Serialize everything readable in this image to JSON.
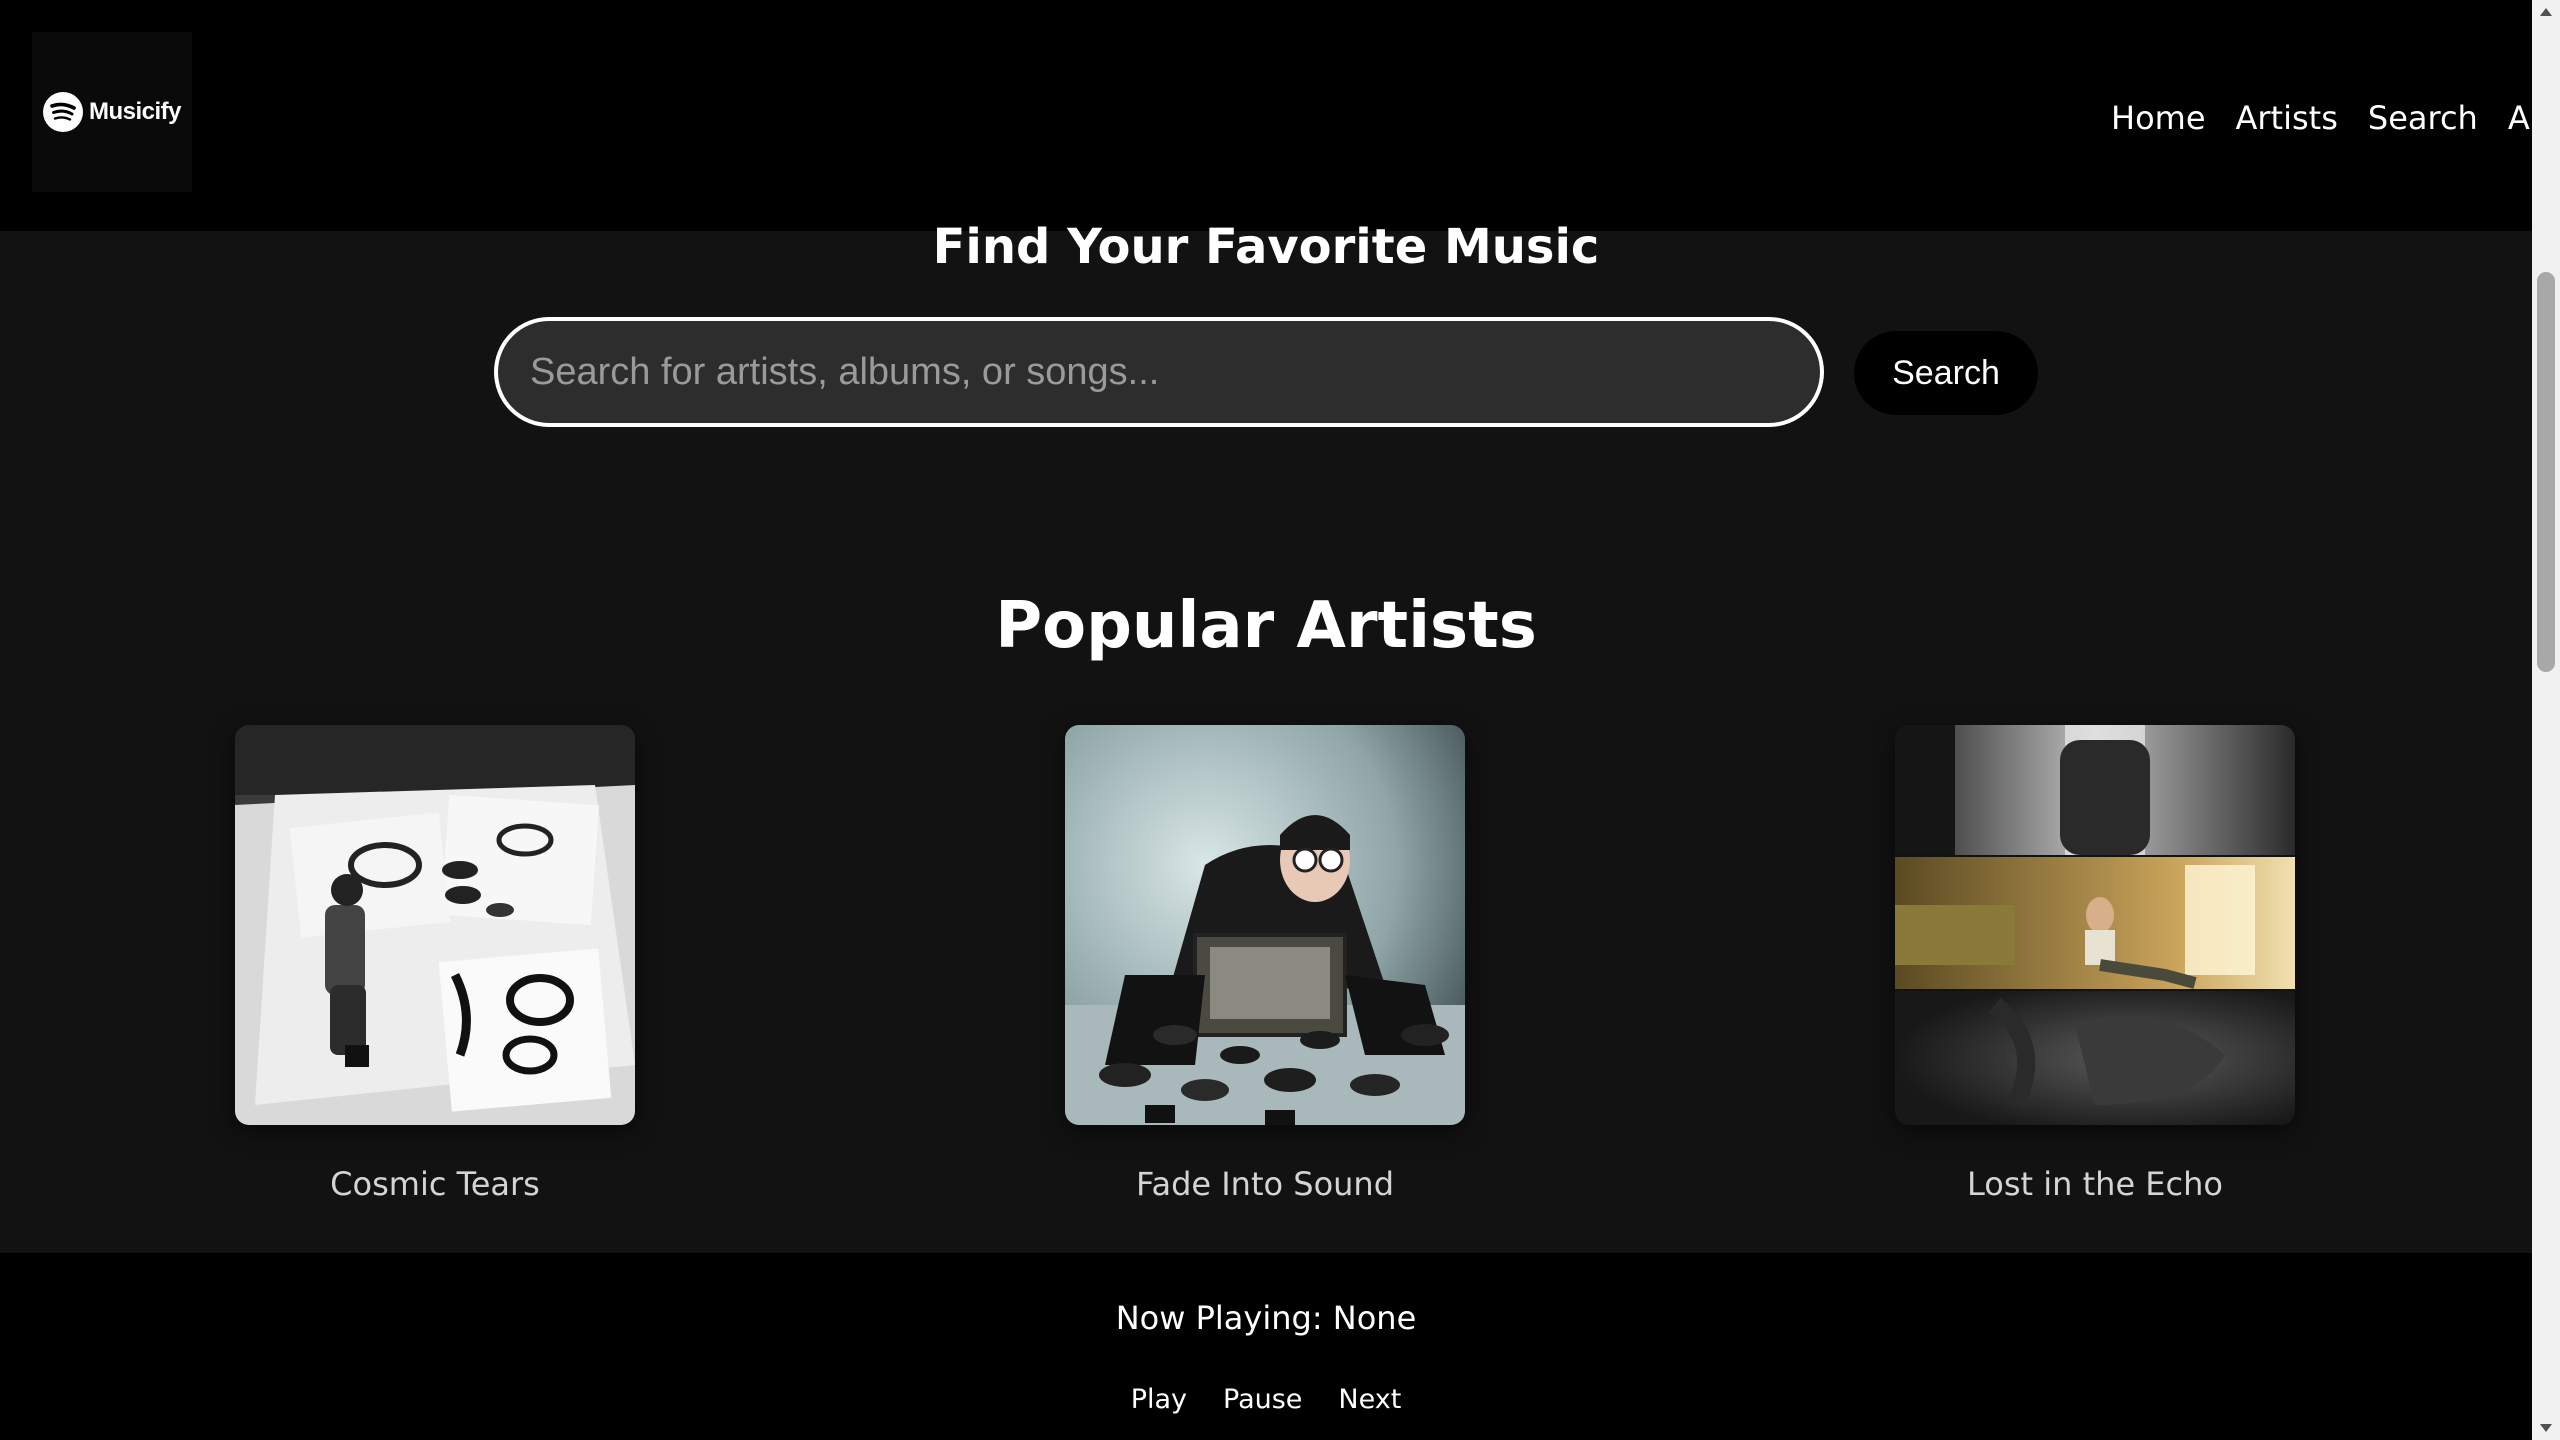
{
  "header": {
    "logo_text": "Musicify",
    "nav": [
      "Home",
      "Artists",
      "Search",
      "Albu"
    ]
  },
  "hero": {
    "title": "Find Your Favorite Music",
    "search_placeholder": "Search for artists, albums, or songs...",
    "search_button": "Search"
  },
  "popular": {
    "title": "Popular Artists",
    "artists": [
      {
        "name": "Cosmic Tears"
      },
      {
        "name": "Fade Into Sound"
      },
      {
        "name": "Lost in the Echo"
      }
    ]
  },
  "player": {
    "now_playing": "Now Playing: None",
    "controls": [
      "Play",
      "Pause",
      "Next"
    ]
  }
}
